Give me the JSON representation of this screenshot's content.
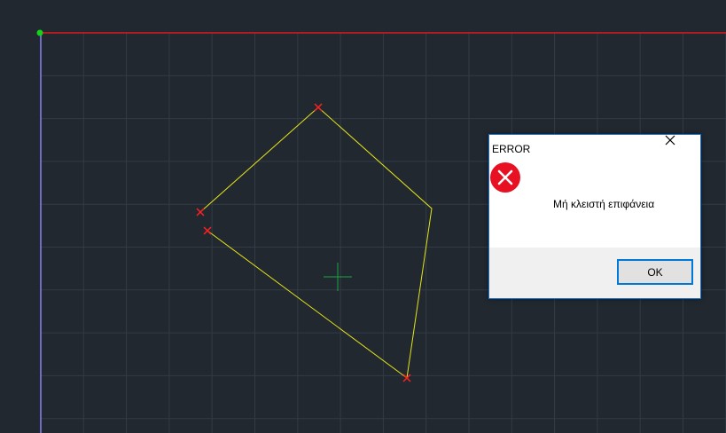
{
  "dialog": {
    "title": "ERROR",
    "message": "Μή κλειστή επιφάνεια",
    "ok_label": "OK",
    "icon": "error-icon",
    "close_icon": "close-icon"
  },
  "canvas": {
    "background": "#212830",
    "grid_color": "#323b46",
    "x_axis_color": "#e0181c",
    "y_axis_color": "#8a84f0",
    "origin_color": "#16d216",
    "polyline_color": "#e6e619",
    "vertex_marker_color": "#ff2020",
    "cursor_color": "#19a640"
  },
  "colors": {
    "accent": "#0078d7",
    "error": "#e81123"
  }
}
